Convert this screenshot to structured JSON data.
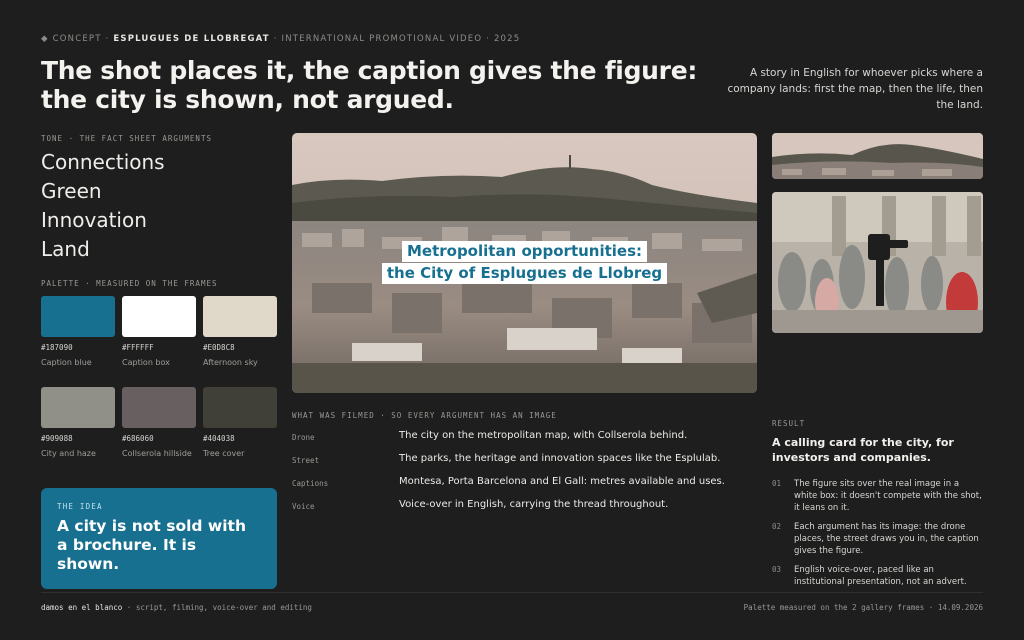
{
  "header": {
    "kicker_prefix": "◆ CONCEPT ·",
    "client": "ESPLUGUES DE LLOBREGAT",
    "kicker_suffix": "· INTERNATIONAL PROMOTIONAL VIDEO · 2025",
    "headline": "The shot places it, the caption gives the figure: the city is shown, not argued.",
    "lede": "A story in English for whoever picks where a company lands: first the map, then the life, then the land."
  },
  "tone": {
    "label": "TONE · THE FACT SHEET ARGUMENTS",
    "items": [
      "Connections",
      "Green",
      "Innovation",
      "Land"
    ]
  },
  "palette": {
    "label": "PALETTE · MEASURED ON THE FRAMES",
    "swatches": [
      {
        "hex": "#187090",
        "name": "Caption blue"
      },
      {
        "hex": "#FFFFFF",
        "name": "Caption box"
      },
      {
        "hex": "#E0D8C8",
        "name": "Afternoon sky"
      },
      {
        "hex": "#909088",
        "name": "City and haze"
      },
      {
        "hex": "#686060",
        "name": "Collserola hillside"
      },
      {
        "hex": "#404038",
        "name": "Tree cover"
      }
    ]
  },
  "idea": {
    "label": "THE IDEA",
    "text": "A city is not sold with a brochure. It is shown."
  },
  "main_frame": {
    "caption_line1": "Metropolitan opportunities:",
    "caption_line2": "the City of Esplugues de Llobreg"
  },
  "filmed": {
    "label": "WHAT WAS FILMED · SO EVERY ARGUMENT HAS AN IMAGE",
    "rows": [
      {
        "key": "Drone",
        "value": "The city on the metropolitan map, with Collserola behind."
      },
      {
        "key": "Street",
        "value": "The parks, the heritage and innovation spaces like the Esplulab."
      },
      {
        "key": "Captions",
        "value": "Montesa, Porta Barcelona and El Gall: metres available and uses."
      },
      {
        "key": "Voice",
        "value": "Voice-over in English, carrying the thread throughout."
      }
    ]
  },
  "result": {
    "label": "RESULT",
    "headline": "A calling card for the city, for investors and companies.",
    "items": [
      {
        "num": "01",
        "text": "The figure sits over the real image in a white box: it doesn't compete with the shot, it leans on it."
      },
      {
        "num": "02",
        "text": "Each argument has its image: the drone places, the street draws you in, the caption gives the figure."
      },
      {
        "num": "03",
        "text": "English voice-over, paced like an institutional presentation, not an advert."
      }
    ]
  },
  "footer": {
    "studio": "damos en el blanco",
    "credits": "· script, filming, voice-over and editing",
    "right": "Palette measured on the 2 gallery frames · 14.09.2026"
  }
}
